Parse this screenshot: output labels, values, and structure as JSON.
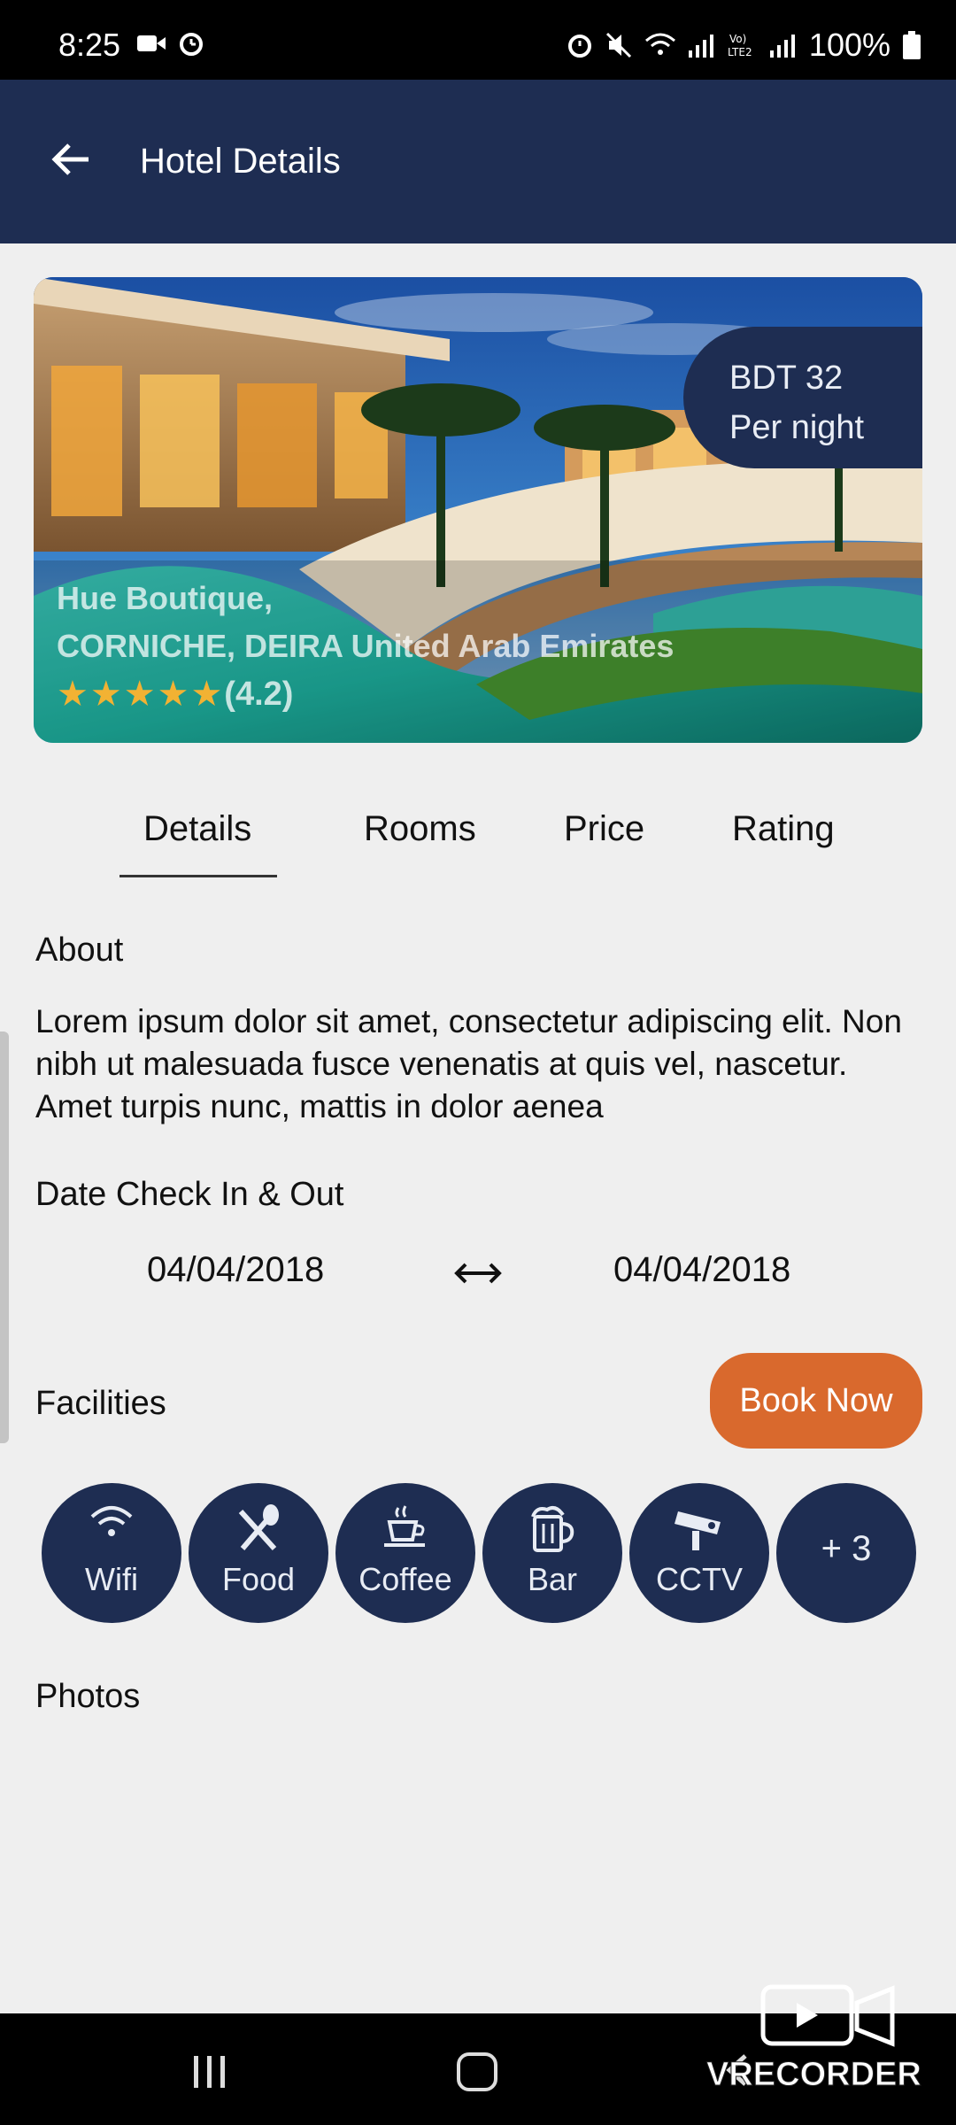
{
  "status_bar": {
    "time": "8:25",
    "battery": "100%"
  },
  "app_bar": {
    "title": "Hotel Details"
  },
  "hero": {
    "price_line1": "BDT 32",
    "price_line2": "Per night",
    "hotel_name": "Hue Boutique,",
    "location": "CORNICHE, DEIRA United Arab Emirates",
    "stars": "★★★★★",
    "rating": "(4.2)"
  },
  "tabs": [
    {
      "label": "Details",
      "active": true
    },
    {
      "label": "Rooms",
      "active": false
    },
    {
      "label": "Price",
      "active": false
    },
    {
      "label": "Rating",
      "active": false
    }
  ],
  "about": {
    "heading": "About",
    "text": "Lorem ipsum dolor sit amet, consectetur adipiscing elit. Non nibh ut malesuada fusce venenatis at quis vel, nascetur. Amet turpis nunc, mattis in dolor aenea"
  },
  "dates": {
    "heading": "Date Check In & Out",
    "check_in": "04/04/2018",
    "check_out": "04/04/2018"
  },
  "facilities": {
    "heading": "Facilities",
    "book_label": "Book Now",
    "items": [
      {
        "label": "Wifi",
        "icon": "wifi-icon"
      },
      {
        "label": "Food",
        "icon": "food-icon"
      },
      {
        "label": "Coffee",
        "icon": "coffee-icon"
      },
      {
        "label": "Bar",
        "icon": "beer-icon"
      },
      {
        "label": "CCTV",
        "icon": "cctv-icon"
      }
    ],
    "more_label": "+ 3"
  },
  "photos": {
    "heading": "Photos"
  },
  "watermark": {
    "text": "VRECORDER"
  },
  "colors": {
    "primary": "#1e2d52",
    "accent": "#d9692d",
    "background": "#efefef",
    "star": "#f2b233"
  }
}
